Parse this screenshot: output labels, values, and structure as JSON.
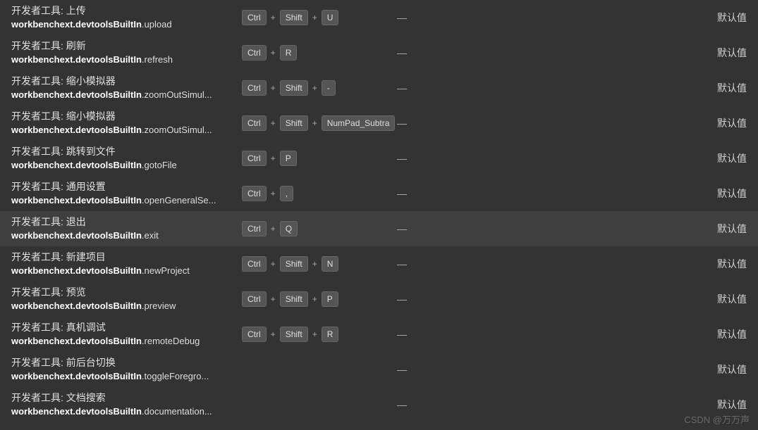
{
  "watermark": "CSDN @万万声",
  "dash": "—",
  "rows": [
    {
      "title": "开发者工具: 上传",
      "idPrefix": "workbenchext.devtoolsBuiltIn",
      "idSuffix": ".upload",
      "keys": [
        "Ctrl",
        "Shift",
        "U"
      ],
      "when": "—",
      "source": "默认值",
      "selected": false
    },
    {
      "title": "开发者工具: 刷新",
      "idPrefix": "workbenchext.devtoolsBuiltIn",
      "idSuffix": ".refresh",
      "keys": [
        "Ctrl",
        "R"
      ],
      "when": "—",
      "source": "默认值",
      "selected": false
    },
    {
      "title": "开发者工具: 缩小模拟器",
      "idPrefix": "workbenchext.devtoolsBuiltIn",
      "idSuffix": ".zoomOutSimul...",
      "keys": [
        "Ctrl",
        "Shift",
        "-"
      ],
      "when": "—",
      "source": "默认值",
      "selected": false
    },
    {
      "title": "开发者工具: 缩小模拟器",
      "idPrefix": "workbenchext.devtoolsBuiltIn",
      "idSuffix": ".zoomOutSimul...",
      "keys": [
        "Ctrl",
        "Shift",
        "NumPad_Subtra"
      ],
      "when": "—",
      "source": "默认值",
      "selected": false
    },
    {
      "title": "开发者工具: 跳转到文件",
      "idPrefix": "workbenchext.devtoolsBuiltIn",
      "idSuffix": ".gotoFile",
      "keys": [
        "Ctrl",
        "P"
      ],
      "when": "—",
      "source": "默认值",
      "selected": false
    },
    {
      "title": "开发者工具: 通用设置",
      "idPrefix": "workbenchext.devtoolsBuiltIn",
      "idSuffix": ".openGeneralSe...",
      "keys": [
        "Ctrl",
        ","
      ],
      "when": "—",
      "source": "默认值",
      "selected": false
    },
    {
      "title": "开发者工具: 退出",
      "idPrefix": "workbenchext.devtoolsBuiltIn",
      "idSuffix": ".exit",
      "keys": [
        "Ctrl",
        "Q"
      ],
      "when": "—",
      "source": "默认值",
      "selected": true
    },
    {
      "title": "开发者工具: 新建项目",
      "idPrefix": "workbenchext.devtoolsBuiltIn",
      "idSuffix": ".newProject",
      "keys": [
        "Ctrl",
        "Shift",
        "N"
      ],
      "when": "—",
      "source": "默认值",
      "selected": false
    },
    {
      "title": "开发者工具: 预览",
      "idPrefix": "workbenchext.devtoolsBuiltIn",
      "idSuffix": ".preview",
      "keys": [
        "Ctrl",
        "Shift",
        "P"
      ],
      "when": "—",
      "source": "默认值",
      "selected": false
    },
    {
      "title": "开发者工具: 真机调试",
      "idPrefix": "workbenchext.devtoolsBuiltIn",
      "idSuffix": ".remoteDebug",
      "keys": [
        "Ctrl",
        "Shift",
        "R"
      ],
      "when": "—",
      "source": "默认值",
      "selected": false
    },
    {
      "title": "开发者工具: 前后台切换",
      "idPrefix": "workbenchext.devtoolsBuiltIn",
      "idSuffix": ".toggleForegro...",
      "keys": [],
      "when": "—",
      "source": "默认值",
      "selected": false
    },
    {
      "title": "开发者工具: 文档搜索",
      "idPrefix": "workbenchext.devtoolsBuiltIn",
      "idSuffix": ".documentation...",
      "keys": [],
      "when": "—",
      "source": "默认值",
      "selected": false
    }
  ]
}
